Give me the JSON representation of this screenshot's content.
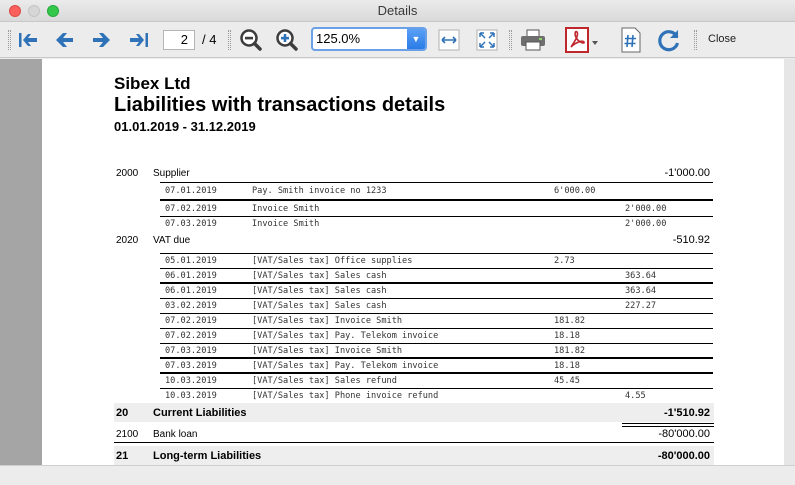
{
  "window": {
    "title": "Details"
  },
  "toolbar": {
    "page_current": "2",
    "page_total": "/ 4",
    "zoom_value": "125.0%",
    "close_label": "Close",
    "icons": [
      "first-page-icon",
      "prev-page-icon",
      "next-page-icon",
      "last-page-icon",
      "zoom-out-icon",
      "zoom-in-icon",
      "fit-width-icon",
      "fit-page-icon",
      "print-icon",
      "pdf-icon",
      "page-number-icon",
      "refresh-icon"
    ]
  },
  "report": {
    "company": "Sibex Ltd",
    "title": "Liabilities with transactions details",
    "period": "01.01.2019 - 31.12.2019",
    "accounts": [
      {
        "code": "2000",
        "name": "Supplier",
        "balance": "-1'000.00",
        "transactions": [
          {
            "date": "07.01.2019",
            "text": "Pay. Smith invoice no 1233",
            "debit": "6'000.00",
            "credit": ""
          },
          {
            "date": "07.02.2019",
            "text": "Invoice Smith",
            "debit": "",
            "credit": "2'000.00"
          },
          {
            "date": "07.03.2019",
            "text": "Invoice Smith",
            "debit": "",
            "credit": "2'000.00"
          }
        ]
      },
      {
        "code": "2020",
        "name": "VAT due",
        "balance": "-510.92",
        "transactions": [
          {
            "date": "05.01.2019",
            "text": "[VAT/Sales tax] Office supplies",
            "debit": "2.73",
            "credit": ""
          },
          {
            "date": "06.01.2019",
            "text": "[VAT/Sales tax] Sales cash",
            "debit": "",
            "credit": "363.64"
          },
          {
            "date": "06.01.2019",
            "text": "[VAT/Sales tax] Sales cash",
            "debit": "",
            "credit": "363.64"
          },
          {
            "date": "03.02.2019",
            "text": "[VAT/Sales tax] Sales cash",
            "debit": "",
            "credit": "227.27"
          },
          {
            "date": "07.02.2019",
            "text": "[VAT/Sales tax] Invoice Smith",
            "debit": "181.82",
            "credit": ""
          },
          {
            "date": "07.02.2019",
            "text": "[VAT/Sales tax] Pay. Telekom invoice",
            "debit": "18.18",
            "credit": ""
          },
          {
            "date": "07.03.2019",
            "text": "[VAT/Sales tax] Invoice Smith",
            "debit": "181.82",
            "credit": ""
          },
          {
            "date": "07.03.2019",
            "text": "[VAT/Sales tax] Pay. Telekom invoice",
            "debit": "18.18",
            "credit": ""
          },
          {
            "date": "10.03.2019",
            "text": "[VAT/Sales tax] Sales refund",
            "debit": "45.45",
            "credit": ""
          },
          {
            "date": "10.03.2019",
            "text": "[VAT/Sales tax] Phone invoice refund",
            "debit": "",
            "credit": "4.55"
          }
        ]
      }
    ],
    "current_total": {
      "code": "20",
      "name": "Current Liabilities",
      "balance": "-1'510.92"
    },
    "bank_loan": {
      "code": "2100",
      "name": "Bank loan",
      "balance": "-80'000.00"
    },
    "longterm_total": {
      "code": "21",
      "name": "Long-term Liabilities",
      "balance": "-80'000.00"
    }
  }
}
